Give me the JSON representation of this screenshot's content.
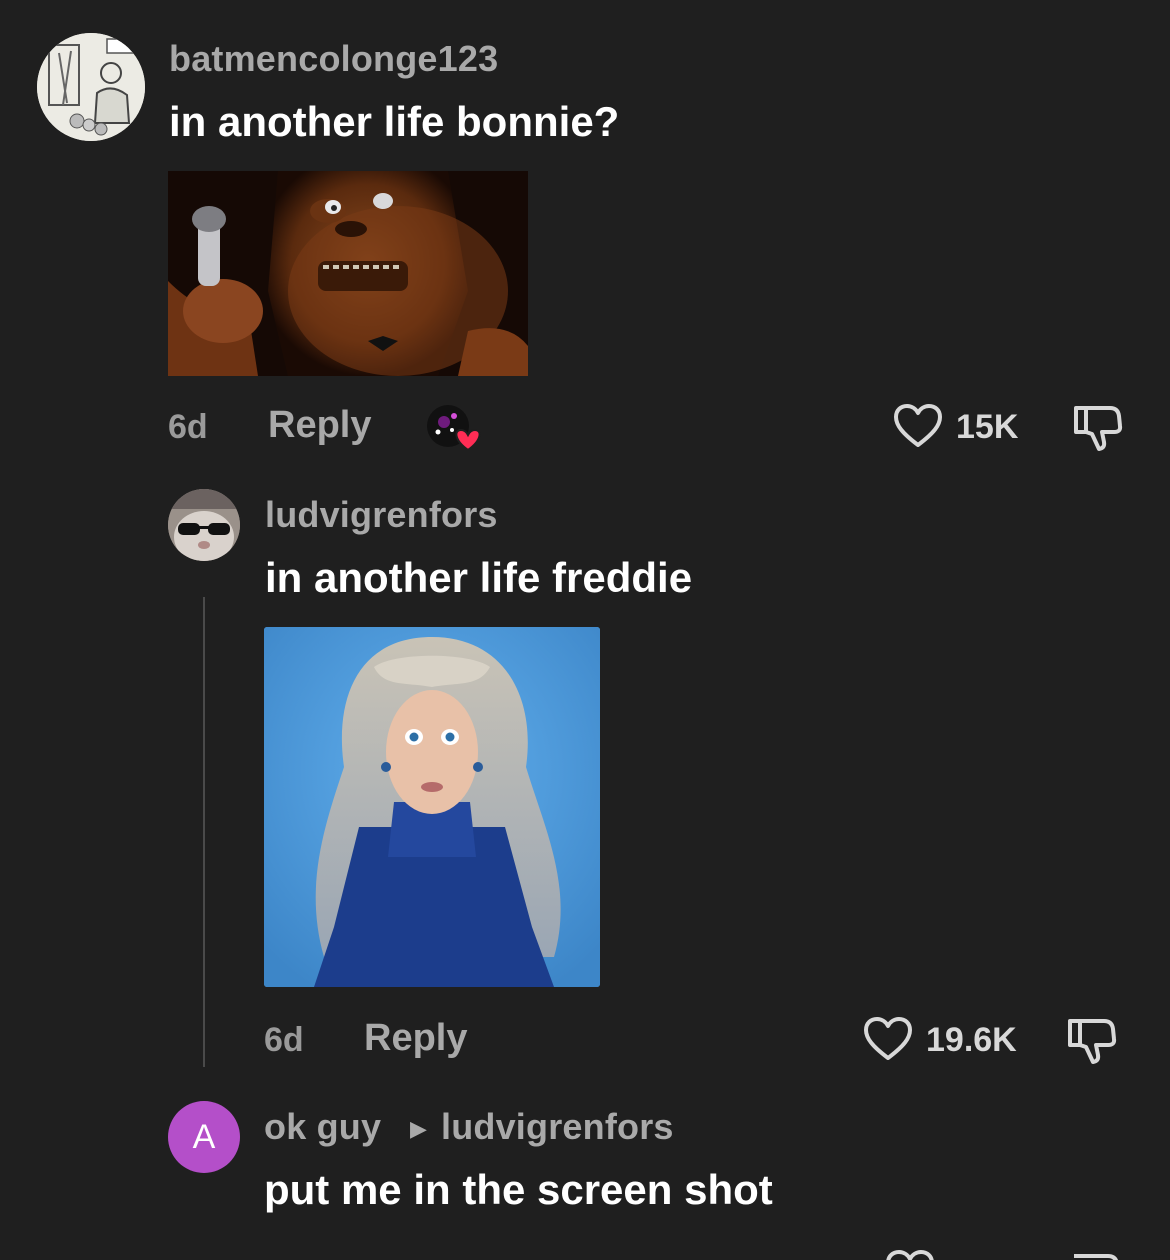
{
  "comments": [
    {
      "username": "batmencolonge123",
      "text": "in another life bonnie?",
      "time": "6d",
      "reply_label": "Reply",
      "likes": "15K"
    },
    {
      "username": "ludvigrenfors",
      "text": "in another life freddie",
      "time": "6d",
      "reply_label": "Reply",
      "likes": "19.6K"
    },
    {
      "username": "ok guy",
      "reply_to": "ludvigrenfors",
      "avatar_letter": "A",
      "text": "put me in the screen shot"
    }
  ],
  "colors": {
    "background": "#1f1f1f",
    "username": "#a9a9a9",
    "text": "#ffffff",
    "avatar_purple": "#b44fc9",
    "heart_red": "#ff2d55"
  }
}
